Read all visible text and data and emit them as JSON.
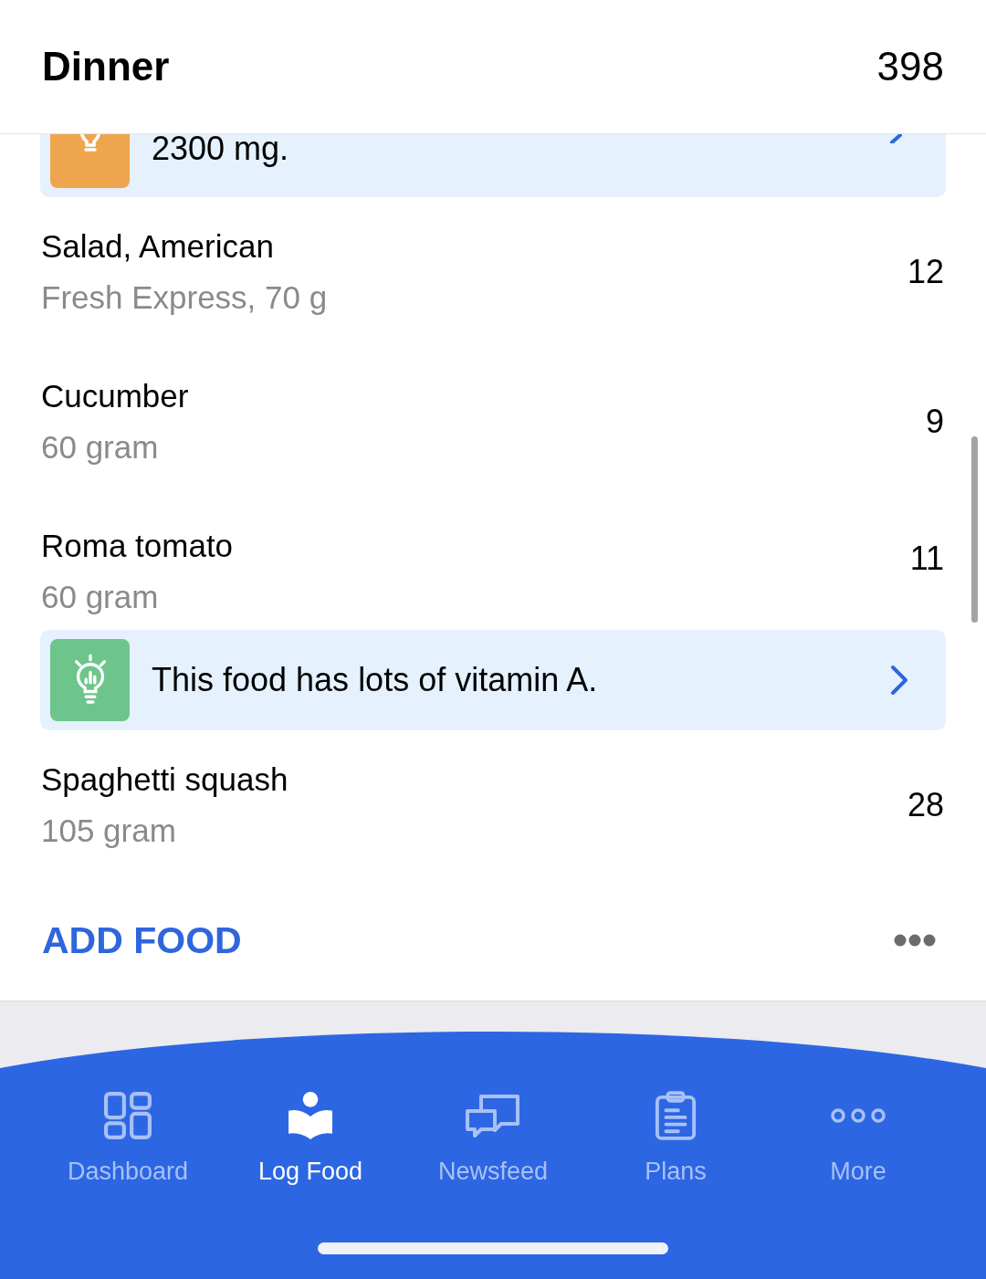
{
  "header": {
    "title": "Dinner",
    "calories": "398"
  },
  "entries": [
    {
      "kind": "tip",
      "text": "2300 mg.",
      "color": "#eea54d",
      "clipped": true
    },
    {
      "kind": "food",
      "name": "Salad, American",
      "amount": "Fresh Express, 70 g",
      "calories": "12"
    },
    {
      "kind": "food",
      "name": "Cucumber",
      "amount": "60 gram",
      "calories": "9"
    },
    {
      "kind": "food",
      "name": "Roma tomato",
      "amount": "60 gram",
      "calories": "11"
    },
    {
      "kind": "tip",
      "text": "This food has lots of vitamin A.",
      "color": "#6dc58b",
      "clipped": false
    },
    {
      "kind": "food",
      "name": "Spaghetti squash",
      "amount": "105 gram",
      "calories": "28"
    }
  ],
  "add_food": {
    "label": "ADD FOOD"
  },
  "tabs": [
    {
      "label": "Dashboard",
      "selected": false
    },
    {
      "label": "Log Food",
      "selected": true
    },
    {
      "label": "Newsfeed",
      "selected": false
    },
    {
      "label": "Plans",
      "selected": false
    },
    {
      "label": "More",
      "selected": false
    }
  ]
}
